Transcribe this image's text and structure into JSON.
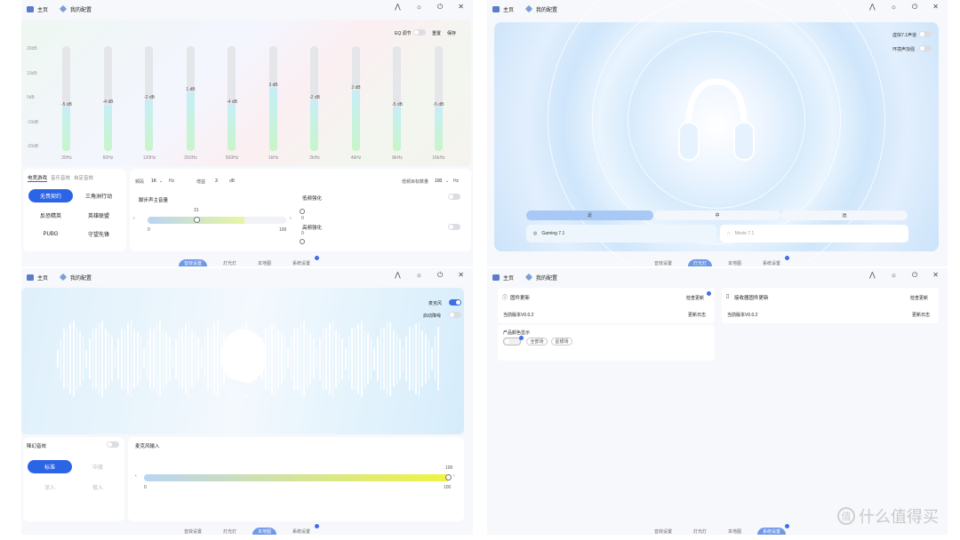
{
  "topbar": {
    "brand": "主页",
    "config": "我的配置",
    "icons": [
      "person-icon",
      "sun-icon",
      "power-icon",
      "close-icon"
    ]
  },
  "tabs": [
    "音效设置",
    "灯光灯",
    "本地图",
    "系统设置"
  ],
  "eq": {
    "toggle_label": "EQ 调节",
    "reset": "重置",
    "save": "保存",
    "axis": [
      "20dB",
      "10dB",
      "0dB",
      "-10dB",
      "-20dB"
    ],
    "bands": [
      {
        "freq": "30Hz",
        "gain": "-5 dB",
        "value": -5
      },
      {
        "freq": "60Hz",
        "gain": "-4 dB",
        "value": -4
      },
      {
        "freq": "120Hz",
        "gain": "-2 dB",
        "value": -2
      },
      {
        "freq": "250Hz",
        "gain": "1 dB",
        "value": 1
      },
      {
        "freq": "500Hz",
        "gain": "-4 dB",
        "value": -4
      },
      {
        "freq": "1kHz",
        "gain": "3 dB",
        "value": 3
      },
      {
        "freq": "2kHz",
        "gain": "-2 dB",
        "value": -2
      },
      {
        "freq": "4kHz",
        "gain": "2 dB",
        "value": 2
      },
      {
        "freq": "8kHz",
        "gain": "-5 dB",
        "value": -5
      },
      {
        "freq": "16kHz",
        "gain": "-5 dB",
        "value": -5
      }
    ],
    "categories": [
      "电竞游戏",
      "音乐音效",
      "自定音效"
    ],
    "presets": [
      "无畏契约",
      "三角洲行动",
      "反恐精英",
      "英雄联盟",
      "PUBG",
      "守望先锋"
    ],
    "freq_label": "频段",
    "freq_value": "1K",
    "freq_unit": "Hz",
    "gain_label": "增益",
    "gain_value": "3",
    "gain_unit": "dB",
    "low_label": "低频目标数量",
    "low_value": "100",
    "low_unit": "Hz",
    "footstep_label": "脚步声主音量",
    "footstep_value": "31",
    "slider_min": "0",
    "slider_max": "100",
    "bass_label": "低频强化",
    "treble_label": "高频强化",
    "enh_min": "0"
  },
  "surround": {
    "toggle1": "虚拟7.1声道",
    "toggle2": "环境声加强",
    "modes": [
      "近",
      "中",
      "远"
    ],
    "cards": [
      "Gaming 7.1",
      "Movie 7.1"
    ]
  },
  "mic": {
    "toggle1": "麦克风",
    "toggle2": "启动降噪",
    "ai_label": "降幻音效",
    "ai_buttons": [
      "标准",
      "中度",
      "深入",
      "极入"
    ],
    "input_label": "麦克风输入",
    "input_value": "100",
    "input_min": "0",
    "input_max": "100"
  },
  "firmware": {
    "left_title": "固件更新",
    "left_check": "检查更新",
    "left_version": "当前版本V0.0.2",
    "left_log": "更新日志",
    "right_title": "接收器固件更新",
    "right_check": "检查更新",
    "right_version": "当前版本V0.0.2",
    "right_log": "更新日志",
    "color_label": "产品颜色显示",
    "color_opts": [
      "全部场",
      "星银场"
    ]
  },
  "watermark": {
    "text": "什么值得买",
    "glyph": "值"
  },
  "colors": {
    "accent": "#2c64e6",
    "tab_active": "#6e98e8"
  }
}
